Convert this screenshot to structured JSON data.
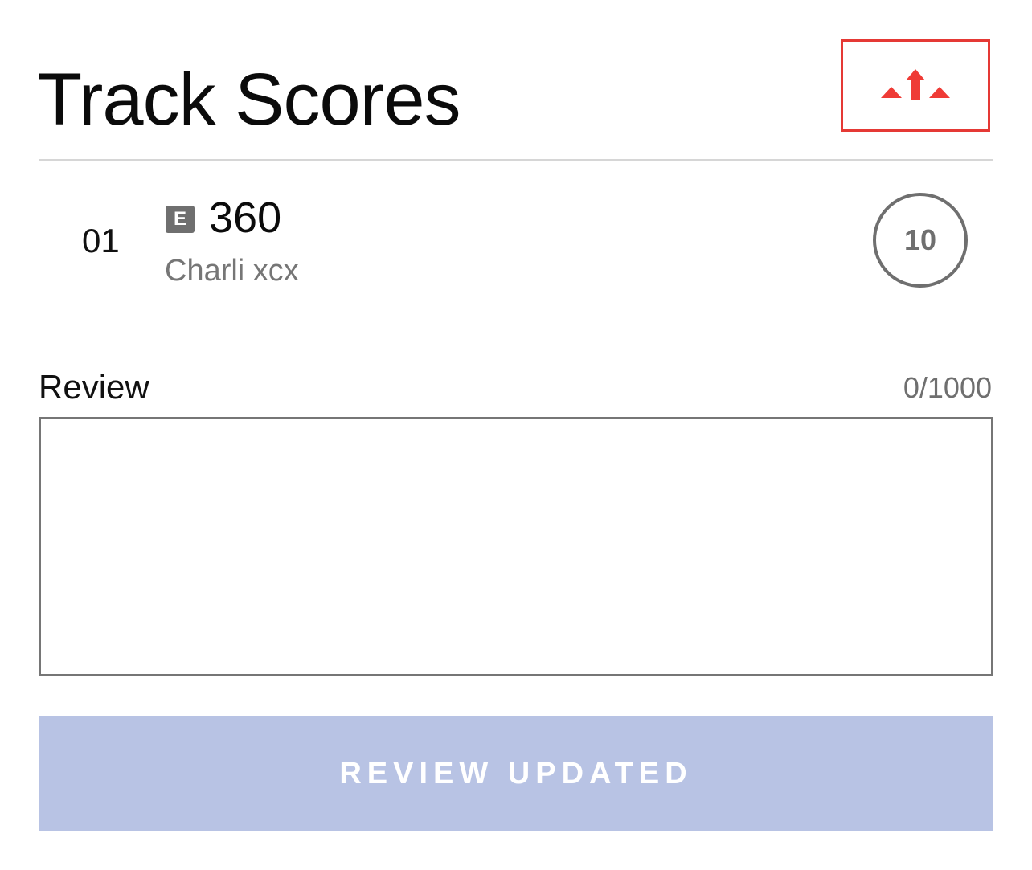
{
  "header": {
    "title": "Track Scores",
    "logo_icon": "triangles-arrow-up-icon",
    "accent_color": "#e53935"
  },
  "track": {
    "number": "01",
    "explicit_badge": "E",
    "title": "360",
    "artist": "Charli xcx",
    "score": "10"
  },
  "review": {
    "label": "Review",
    "char_count": "0/1000",
    "value": "",
    "placeholder": ""
  },
  "submit": {
    "label": "REVIEW UPDATED",
    "color": "#b8c3e4"
  }
}
